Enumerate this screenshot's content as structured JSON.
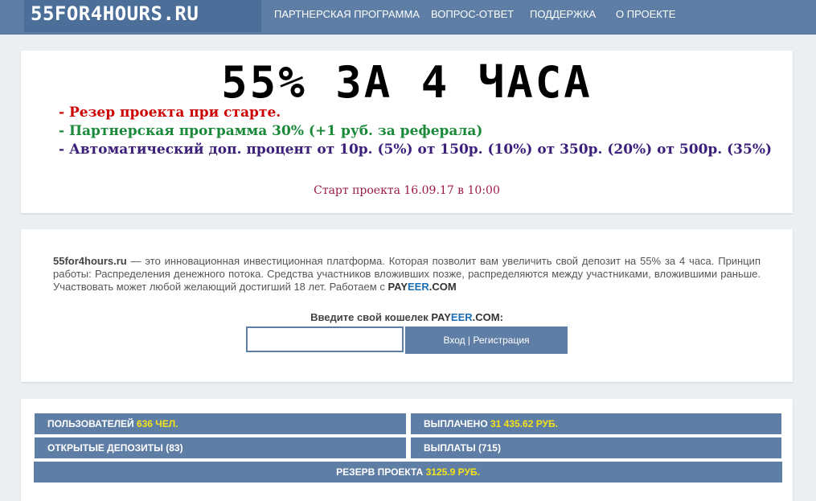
{
  "header": {
    "logo": "55FOR4HOURS.RU",
    "nav": [
      "ПАРТНЕРСКАЯ ПРОГРАММА",
      "ВОПРОС-ОТВЕТ",
      "ПОДДЕРЖКА",
      "О ПРОЕКТЕ"
    ]
  },
  "hero": {
    "title": "55% ЗА 4 ЧАСА",
    "features": [
      "- Резер проекта при старте.",
      "- Партнерская программа 30% (+1 руб. за реферала)",
      "- Автоматический доп. процент от 10р. (5%) от 150р. (10%) от 350р. (20%) от 500р. (35%)"
    ],
    "start": "Старт проекта 16.09.17 в 10:00",
    "colors": {
      "feature1": "#cc0000",
      "feature2": "#1a8a3a",
      "feature3": "#3c1f7a",
      "start": "#9b1a4c"
    }
  },
  "intro": {
    "site": "55for4hours.ru",
    "text": " — это инновационная инвестиционная платформа. Которая позволит вам увеличить свой депозит на 55% за 4 часа. Принцип работы: Распределения денежного потока. Средства участников вложивших позже, распределяются между участниками, вложившими раньше. Участвовать может любой желающий достигший 18 лет. Работаем с ",
    "payeer_a": "PAY",
    "payeer_b": "EER",
    "payeer_c": ".COM"
  },
  "wallet": {
    "label_prefix": "Введите свой кошелек ",
    "payeer_a": "PAY",
    "payeer_b": "EER",
    "payeer_c": ".COM:",
    "input_value": "",
    "button_label": "Вход | Регистрация"
  },
  "stats": {
    "users_label": "ПОЛЬЗОВАТЕЛЕЙ ",
    "users_value": "636 ЧЕЛ.",
    "paid_label": "ВЫПЛАЧЕНО ",
    "paid_value": "31 435.62 РУБ.",
    "deposits": "ОТКРЫТЫЕ ДЕПОЗИТЫ (83)",
    "payouts": "ВЫПЛАТЫ (715)",
    "reserve_label": "РЕЗЕРВ ПРОЕКТА ",
    "reserve_value": "3125.9 РУБ.",
    "highlight_color": "#f5e21a",
    "bar_color": "#5f7ea5"
  }
}
